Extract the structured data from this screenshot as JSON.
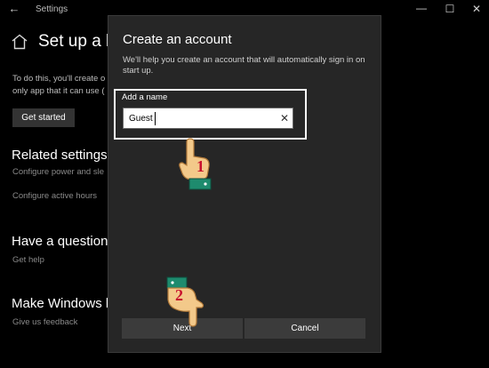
{
  "window": {
    "title": "Settings",
    "back_icon": "back-arrow-icon",
    "minimize_icon": "minimize-icon",
    "maximize_icon": "maximize-icon",
    "close_icon": "close-icon"
  },
  "background": {
    "home_icon": "home-icon",
    "page_title": "Set up a k",
    "desc_line1": "To do this, you'll create o",
    "desc_line2": "only app that it can use (",
    "get_started_label": "Get started",
    "related_heading": "Related settings",
    "related_links": [
      "Configure power and sle",
      "Configure active hours"
    ],
    "question_heading": "Have a question?",
    "help_link": "Get help",
    "better_heading": "Make Windows b",
    "feedback_link": "Give us feedback"
  },
  "dialog": {
    "title": "Create an account",
    "description": "We'll help you create an account that will automatically sign in on start up.",
    "field_label": "Add a name",
    "field_value": "Guest",
    "clear_icon": "clear-icon",
    "next_label": "Next",
    "cancel_label": "Cancel"
  },
  "annotations": {
    "step1": "1",
    "step2": "2",
    "pointer_icon": "pointing-hand-icon",
    "highlight_color": "#ffffff",
    "number_color": "#c8102e",
    "sleeve_color": "#1e8b6e",
    "skin_color": "#f3c98a"
  },
  "colors": {
    "background": "#000000",
    "dialog": "#262626",
    "button": "#3b3b3b"
  }
}
